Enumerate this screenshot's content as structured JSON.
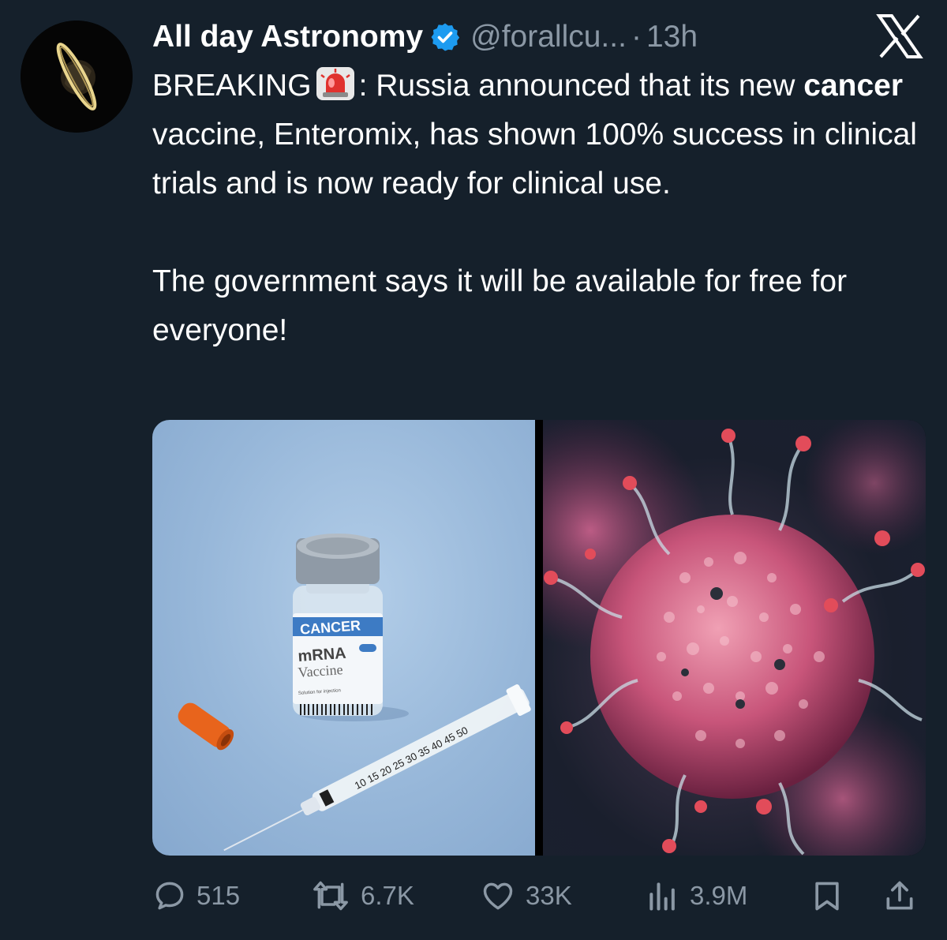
{
  "tweet": {
    "author_name": "All day Astronomy",
    "handle": "@forallcu...",
    "separator": "·",
    "time": "13h",
    "text": {
      "breaking_label": "BREAKING",
      "line1_after_emoji": ": Russia announced that its new",
      "bold_word": "cancer",
      "line2_rest": " vaccine, Enteromix, has shown 100% success in clinical trials and is now ready for clinical use.",
      "paragraph2": "The government says it will be available for free for everyone!"
    },
    "media": {
      "left_image": {
        "vial_label_top": "CANCER",
        "vial_label_main": "mRNA",
        "vial_label_sub": "Vaccine",
        "vial_small_text": "Solution for injection",
        "syringe_markings": "10 15 20 25 30 35 40 45 50"
      }
    },
    "actions": {
      "replies": "515",
      "reposts": "6.7K",
      "likes": "33K",
      "views": "3.9M"
    }
  },
  "icons": {
    "verified": "verified-badge-icon",
    "close": "x-logo-icon",
    "siren": "police-siren-emoji",
    "reply": "reply-icon",
    "repost": "repost-icon",
    "like": "heart-icon",
    "views": "views-icon",
    "bookmark": "bookmark-icon",
    "share": "share-icon"
  },
  "colors": {
    "background": "#15202b",
    "text": "#ffffff",
    "muted": "#8b98a5",
    "verified": "#1d9bf0"
  }
}
